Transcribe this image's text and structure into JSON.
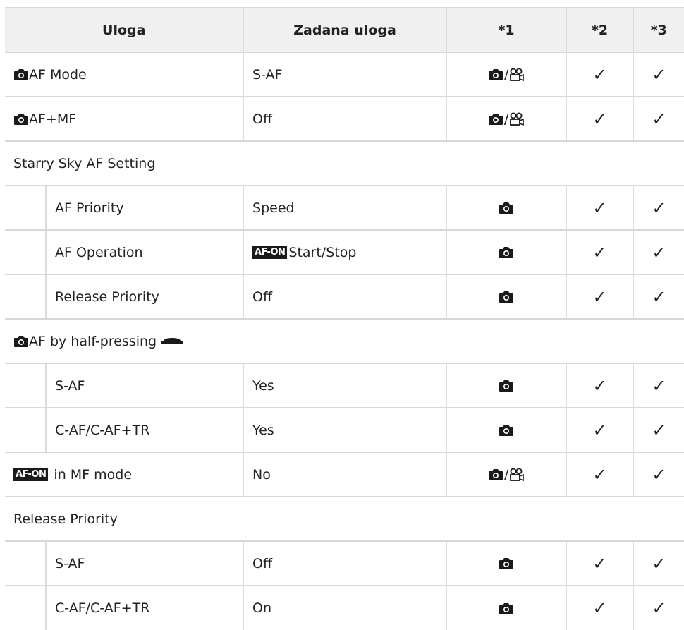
{
  "headers": [
    "Uloga",
    "Zadana uloga",
    "*1",
    "*2",
    "*3"
  ],
  "rows": [
    {
      "type": "row",
      "label": "AF Mode",
      "prefix_icon": "camera-icon",
      "default": "S-AF",
      "mode": "camera-video",
      "c2": "✓",
      "c3": "✓"
    },
    {
      "type": "row",
      "label": "AF+MF",
      "prefix_icon": "camera-icon",
      "default": "Off",
      "mode": "camera-video",
      "c2": "✓",
      "c3": "✓"
    },
    {
      "type": "section",
      "label": "Starry Sky AF Setting"
    },
    {
      "type": "sub",
      "label": "AF Priority",
      "default": "Speed",
      "mode": "camera",
      "c2": "✓",
      "c3": "✓"
    },
    {
      "type": "sub",
      "label": "AF Operation",
      "default_badge": "AF-ON",
      "default": "Start/Stop",
      "mode": "camera",
      "c2": "✓",
      "c3": "✓"
    },
    {
      "type": "sub",
      "label": "Release Priority",
      "default": "Off",
      "mode": "camera",
      "c2": "✓",
      "c3": "✓"
    },
    {
      "type": "section",
      "label": "AF by half-pressing",
      "prefix_icon": "camera-icon",
      "suffix_icon": "shutter-button-icon"
    },
    {
      "type": "sub",
      "label": "S-AF",
      "default": "Yes",
      "mode": "camera",
      "c2": "✓",
      "c3": "✓"
    },
    {
      "type": "sub",
      "label": "C-AF/C-AF+TR",
      "default": "Yes",
      "mode": "camera",
      "c2": "✓",
      "c3": "✓"
    },
    {
      "type": "row",
      "label_badge": "AF-ON",
      "label": " in MF mode",
      "default": "No",
      "mode": "camera-video",
      "c2": "✓",
      "c3": "✓"
    },
    {
      "type": "section",
      "label": "Release Priority"
    },
    {
      "type": "sub",
      "label": "S-AF",
      "default": "Off",
      "mode": "camera",
      "c2": "✓",
      "c3": "✓"
    },
    {
      "type": "sub",
      "label": "C-AF/C-AF+TR",
      "default": "On",
      "mode": "camera",
      "c2": "✓",
      "c3": "✓"
    }
  ]
}
